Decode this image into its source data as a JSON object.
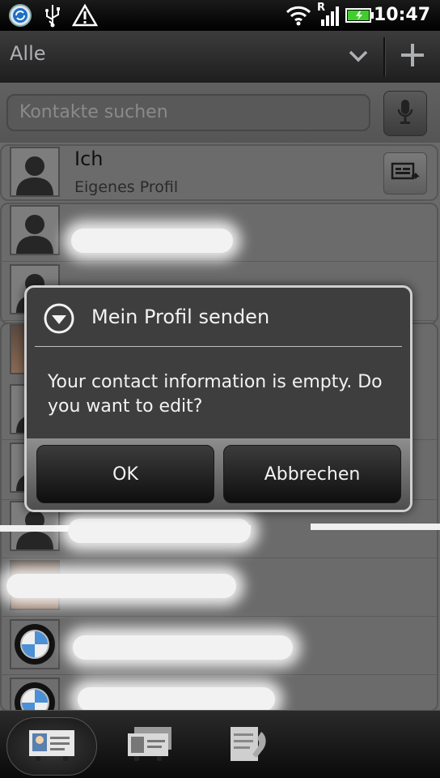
{
  "status_bar": {
    "time": "10:47",
    "network_roaming": "R",
    "icons": [
      "sync-icon",
      "usb-icon",
      "warning-icon",
      "wifi-icon",
      "signal-icon",
      "battery-icon"
    ]
  },
  "header": {
    "filter_label": "Alle"
  },
  "search": {
    "placeholder": "Kontakte suchen"
  },
  "my_profile": {
    "name": "Ich",
    "subtitle": "Eigenes Profil"
  },
  "dialog": {
    "title": "Mein Profil senden",
    "message": "Your contact information is empty. Do you want to edit?",
    "ok_label": "OK",
    "cancel_label": "Abbrechen"
  },
  "bottom_tabs": [
    {
      "name": "contacts-tab",
      "active": true
    },
    {
      "name": "groups-tab",
      "active": false
    },
    {
      "name": "call-history-tab",
      "active": false
    }
  ],
  "colors": {
    "dialog_bg": "#3e3e3e",
    "list_bg": "#6b6b6b",
    "battery_green": "#3fcf2a"
  }
}
